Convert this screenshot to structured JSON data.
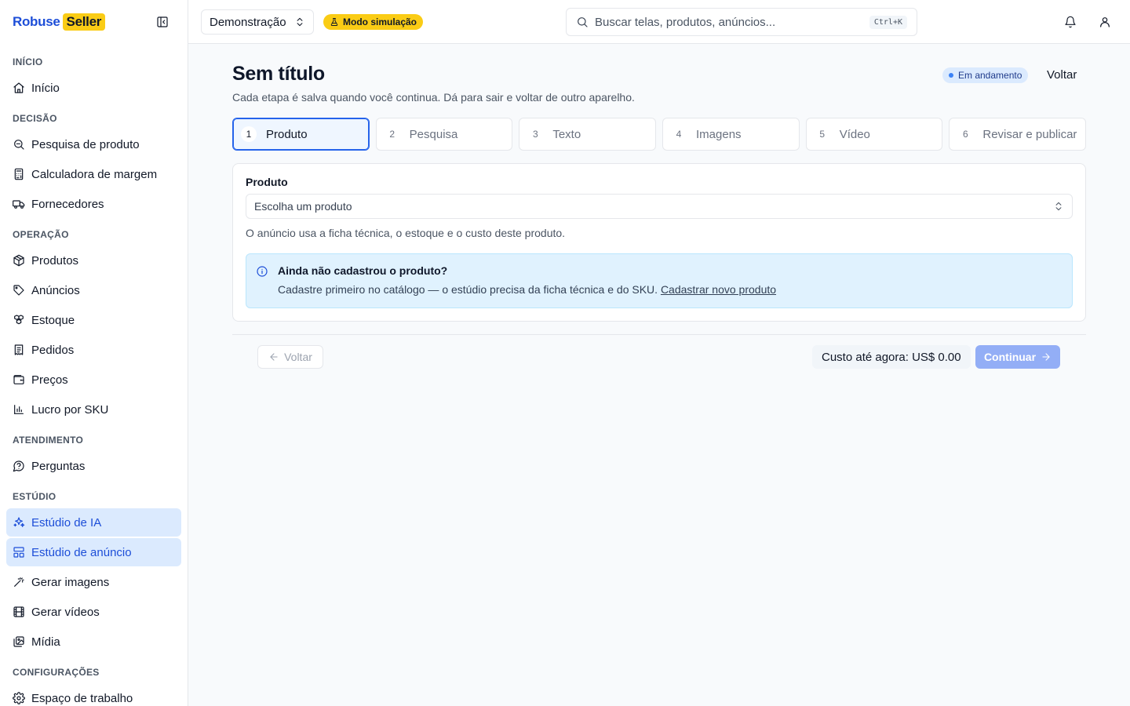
{
  "brand": {
    "name": "Robuse",
    "badge": "Seller"
  },
  "sidebar": {
    "sections": [
      {
        "title": "INÍCIO",
        "items": [
          {
            "label": "Início",
            "icon": "home-icon"
          }
        ]
      },
      {
        "title": "DECISÃO",
        "items": [
          {
            "label": "Pesquisa de produto",
            "icon": "search-zoom-icon"
          },
          {
            "label": "Calculadora de margem",
            "icon": "calculator-icon"
          },
          {
            "label": "Fornecedores",
            "icon": "truck-icon"
          }
        ]
      },
      {
        "title": "OPERAÇÃO",
        "items": [
          {
            "label": "Produtos",
            "icon": "package-icon"
          },
          {
            "label": "Anúncios",
            "icon": "tag-icon"
          },
          {
            "label": "Estoque",
            "icon": "boxes-icon"
          },
          {
            "label": "Pedidos",
            "icon": "receipt-icon"
          },
          {
            "label": "Preços",
            "icon": "wallet-icon"
          },
          {
            "label": "Lucro por SKU",
            "icon": "bar-chart-icon"
          }
        ]
      },
      {
        "title": "ATENDIMENTO",
        "items": [
          {
            "label": "Perguntas",
            "icon": "help-circle-icon"
          }
        ]
      },
      {
        "title": "ESTÚDIO",
        "items": [
          {
            "label": "Estúdio de IA",
            "icon": "sparkles-icon",
            "active": true
          },
          {
            "label": "Estúdio de anúncio",
            "icon": "layout-icon",
            "active": true
          },
          {
            "label": "Gerar imagens",
            "icon": "wand-icon"
          },
          {
            "label": "Gerar vídeos",
            "icon": "film-icon"
          },
          {
            "label": "Mídia",
            "icon": "images-icon"
          }
        ]
      },
      {
        "title": "CONFIGURAÇÕES",
        "items": [
          {
            "label": "Espaço de trabalho",
            "icon": "gear-icon"
          }
        ]
      }
    ]
  },
  "topbar": {
    "workspace": "Demonstração",
    "sim_badge": "Modo simulação",
    "search_placeholder": "Buscar telas, produtos, anúncios...",
    "shortcut": "Ctrl+K"
  },
  "page": {
    "title": "Sem título",
    "subtitle": "Cada etapa é salva quando você continua. Dá para sair e voltar de outro aparelho.",
    "status": "Em andamento",
    "back_link": "Voltar",
    "steps": [
      {
        "num": "1",
        "label": "Produto",
        "active": true
      },
      {
        "num": "2",
        "label": "Pesquisa"
      },
      {
        "num": "3",
        "label": "Texto"
      },
      {
        "num": "4",
        "label": "Imagens"
      },
      {
        "num": "5",
        "label": "Vídeo"
      },
      {
        "num": "6",
        "label": "Revisar e publicar"
      }
    ],
    "product_field": {
      "label": "Produto",
      "placeholder": "Escolha um produto",
      "help": "O anúncio usa a ficha técnica, o estoque e o custo deste produto."
    },
    "info": {
      "title": "Ainda não cadastrou o produto?",
      "text": "Cadastre primeiro no catálogo — o estúdio precisa da ficha técnica e do SKU. ",
      "link": "Cadastrar novo produto"
    },
    "footer": {
      "back_button": "Voltar",
      "cost": "Custo até agora: US$ 0.00",
      "continue_button": "Continuar"
    }
  },
  "colors": {
    "accent": "#2563eb",
    "brand_badge": "#facc15",
    "active_nav_bg": "#dbeafe"
  }
}
